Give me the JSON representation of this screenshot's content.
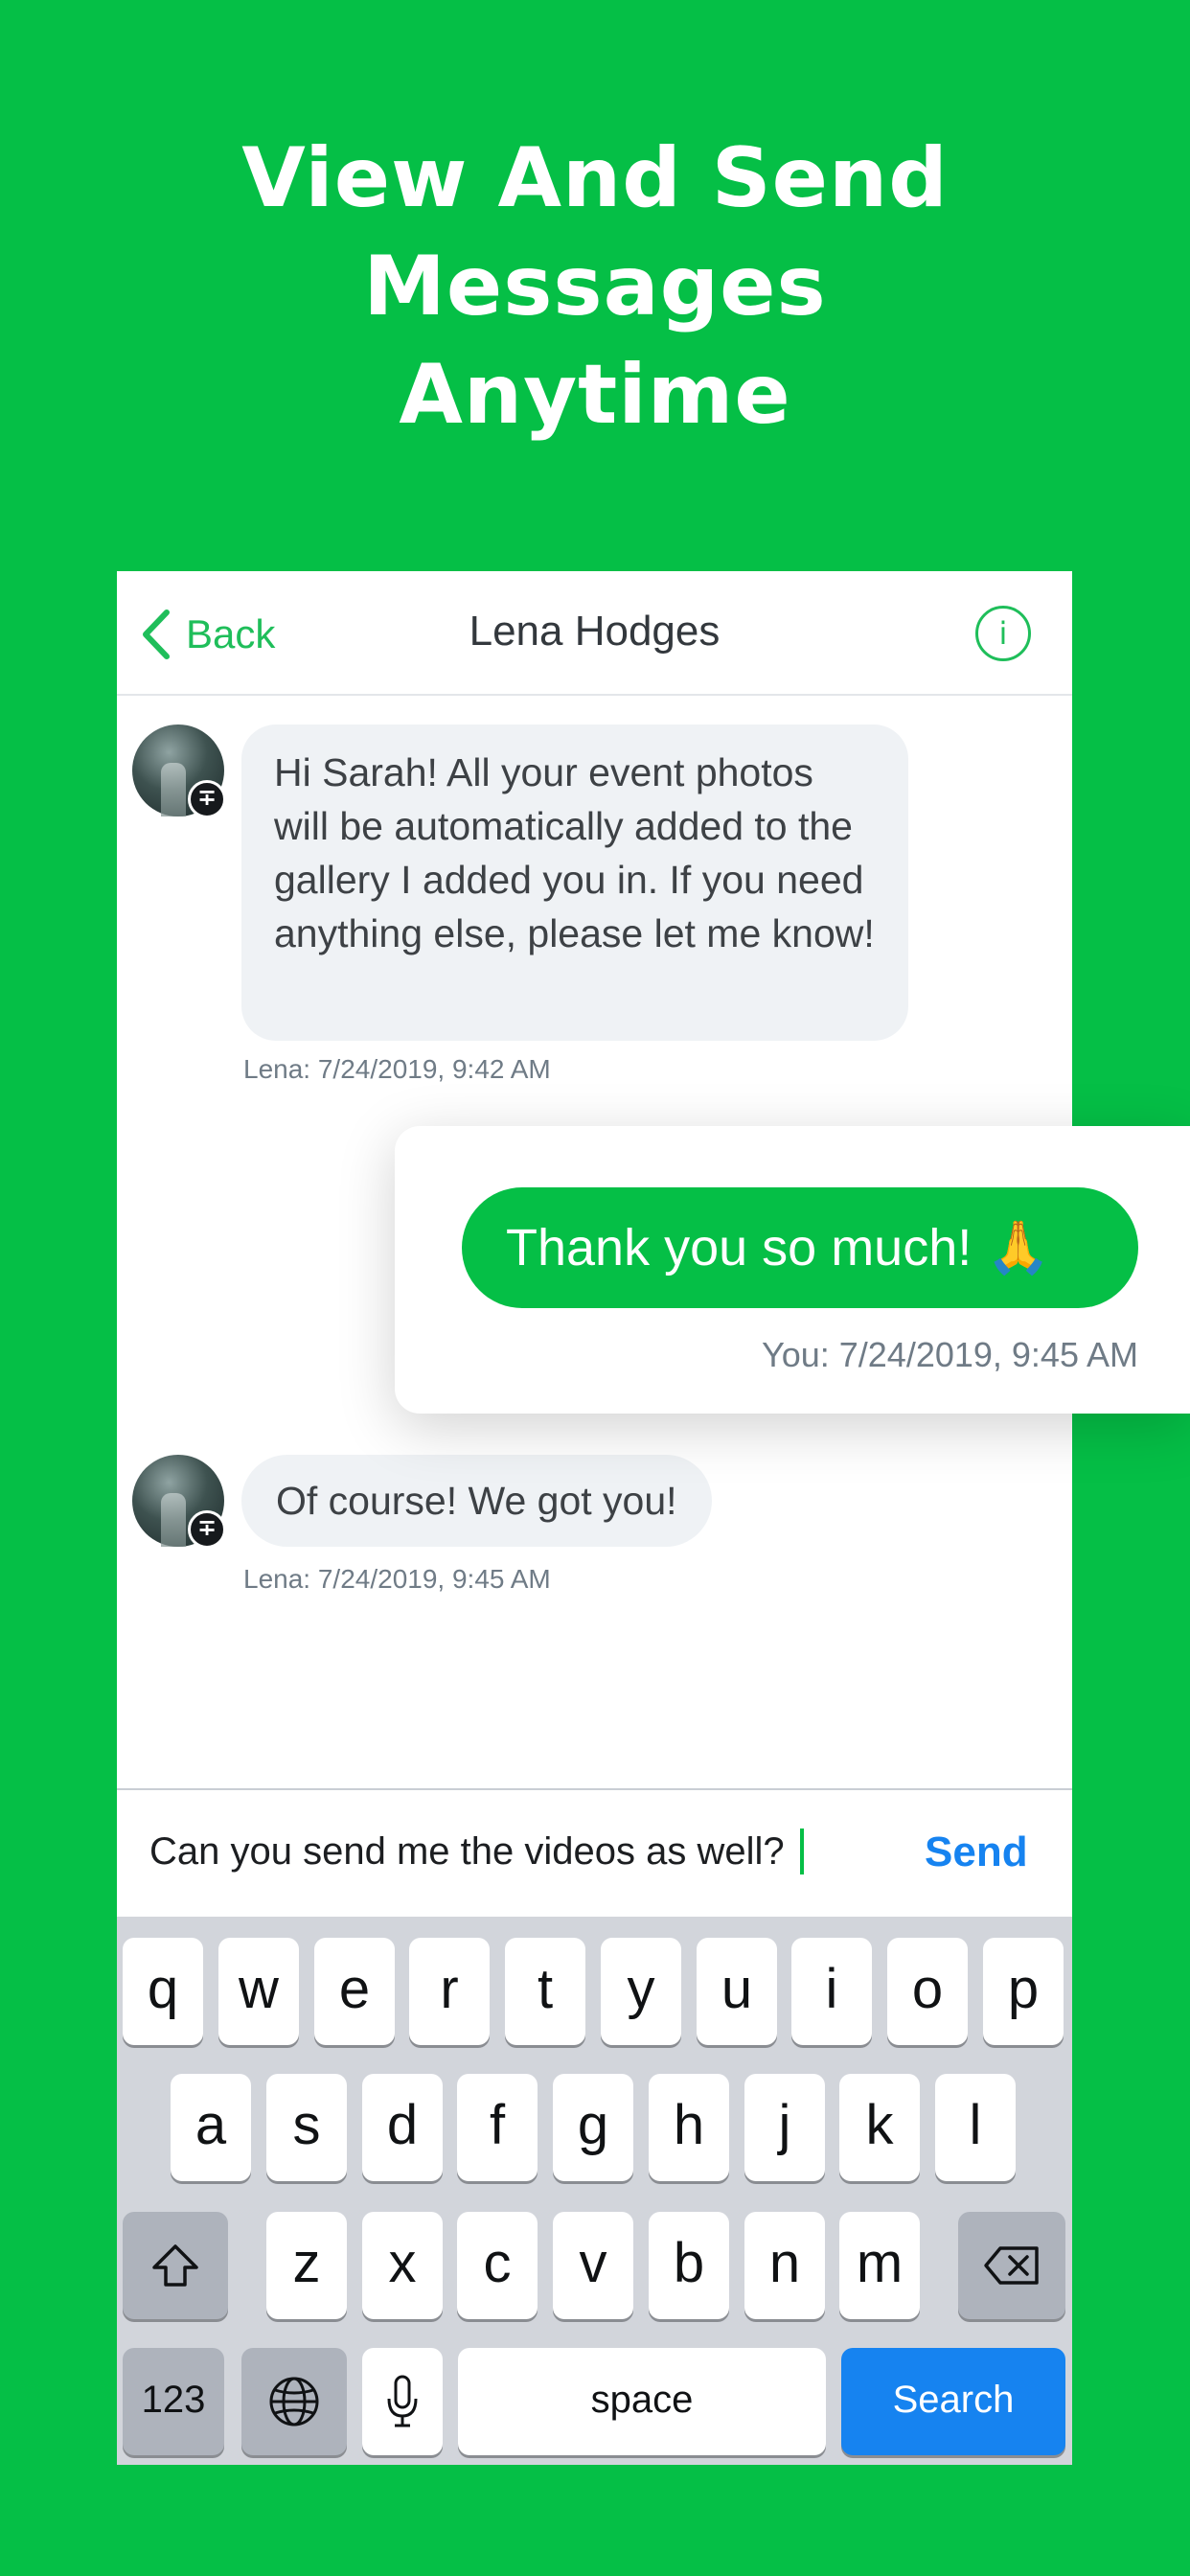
{
  "headline": [
    "View And Send",
    "Messages",
    "Anytime"
  ],
  "navbar": {
    "back_label": "Back",
    "title": "Lena Hodges",
    "info_label": "i"
  },
  "messages": [
    {
      "text": "Hi Sarah! All your event photos will be automatically added to the gallery I added you in. If you need anything else, please let me know!",
      "meta": "Lena: 7/24/2019, 9:42 AM"
    },
    {
      "text": "Thank you so much! 🙏",
      "meta": "You: 7/24/2019, 9:45 AM"
    },
    {
      "text": "Of course! We got you!",
      "meta": "Lena: 7/24/2019, 9:45 AM"
    }
  ],
  "compose": {
    "value": "Can you send me the videos as well?",
    "send_label": "Send"
  },
  "keyboard": {
    "row1": [
      "q",
      "w",
      "e",
      "r",
      "t",
      "y",
      "u",
      "i",
      "o",
      "p"
    ],
    "row2": [
      "a",
      "s",
      "d",
      "f",
      "g",
      "h",
      "j",
      "k",
      "l"
    ],
    "row3": [
      "z",
      "x",
      "c",
      "v",
      "b",
      "n",
      "m"
    ],
    "numbers_label": "123",
    "space_label": "space",
    "return_label": "Search"
  },
  "colors": {
    "brand_green": "#05bf46",
    "send_blue": "#1683f0",
    "bubble_gray": "#eff2f5"
  },
  "icons": [
    "chevron-left-icon",
    "info-icon",
    "avatar-badge-icon",
    "shift-icon",
    "delete-icon",
    "globe-icon",
    "microphone-icon"
  ]
}
